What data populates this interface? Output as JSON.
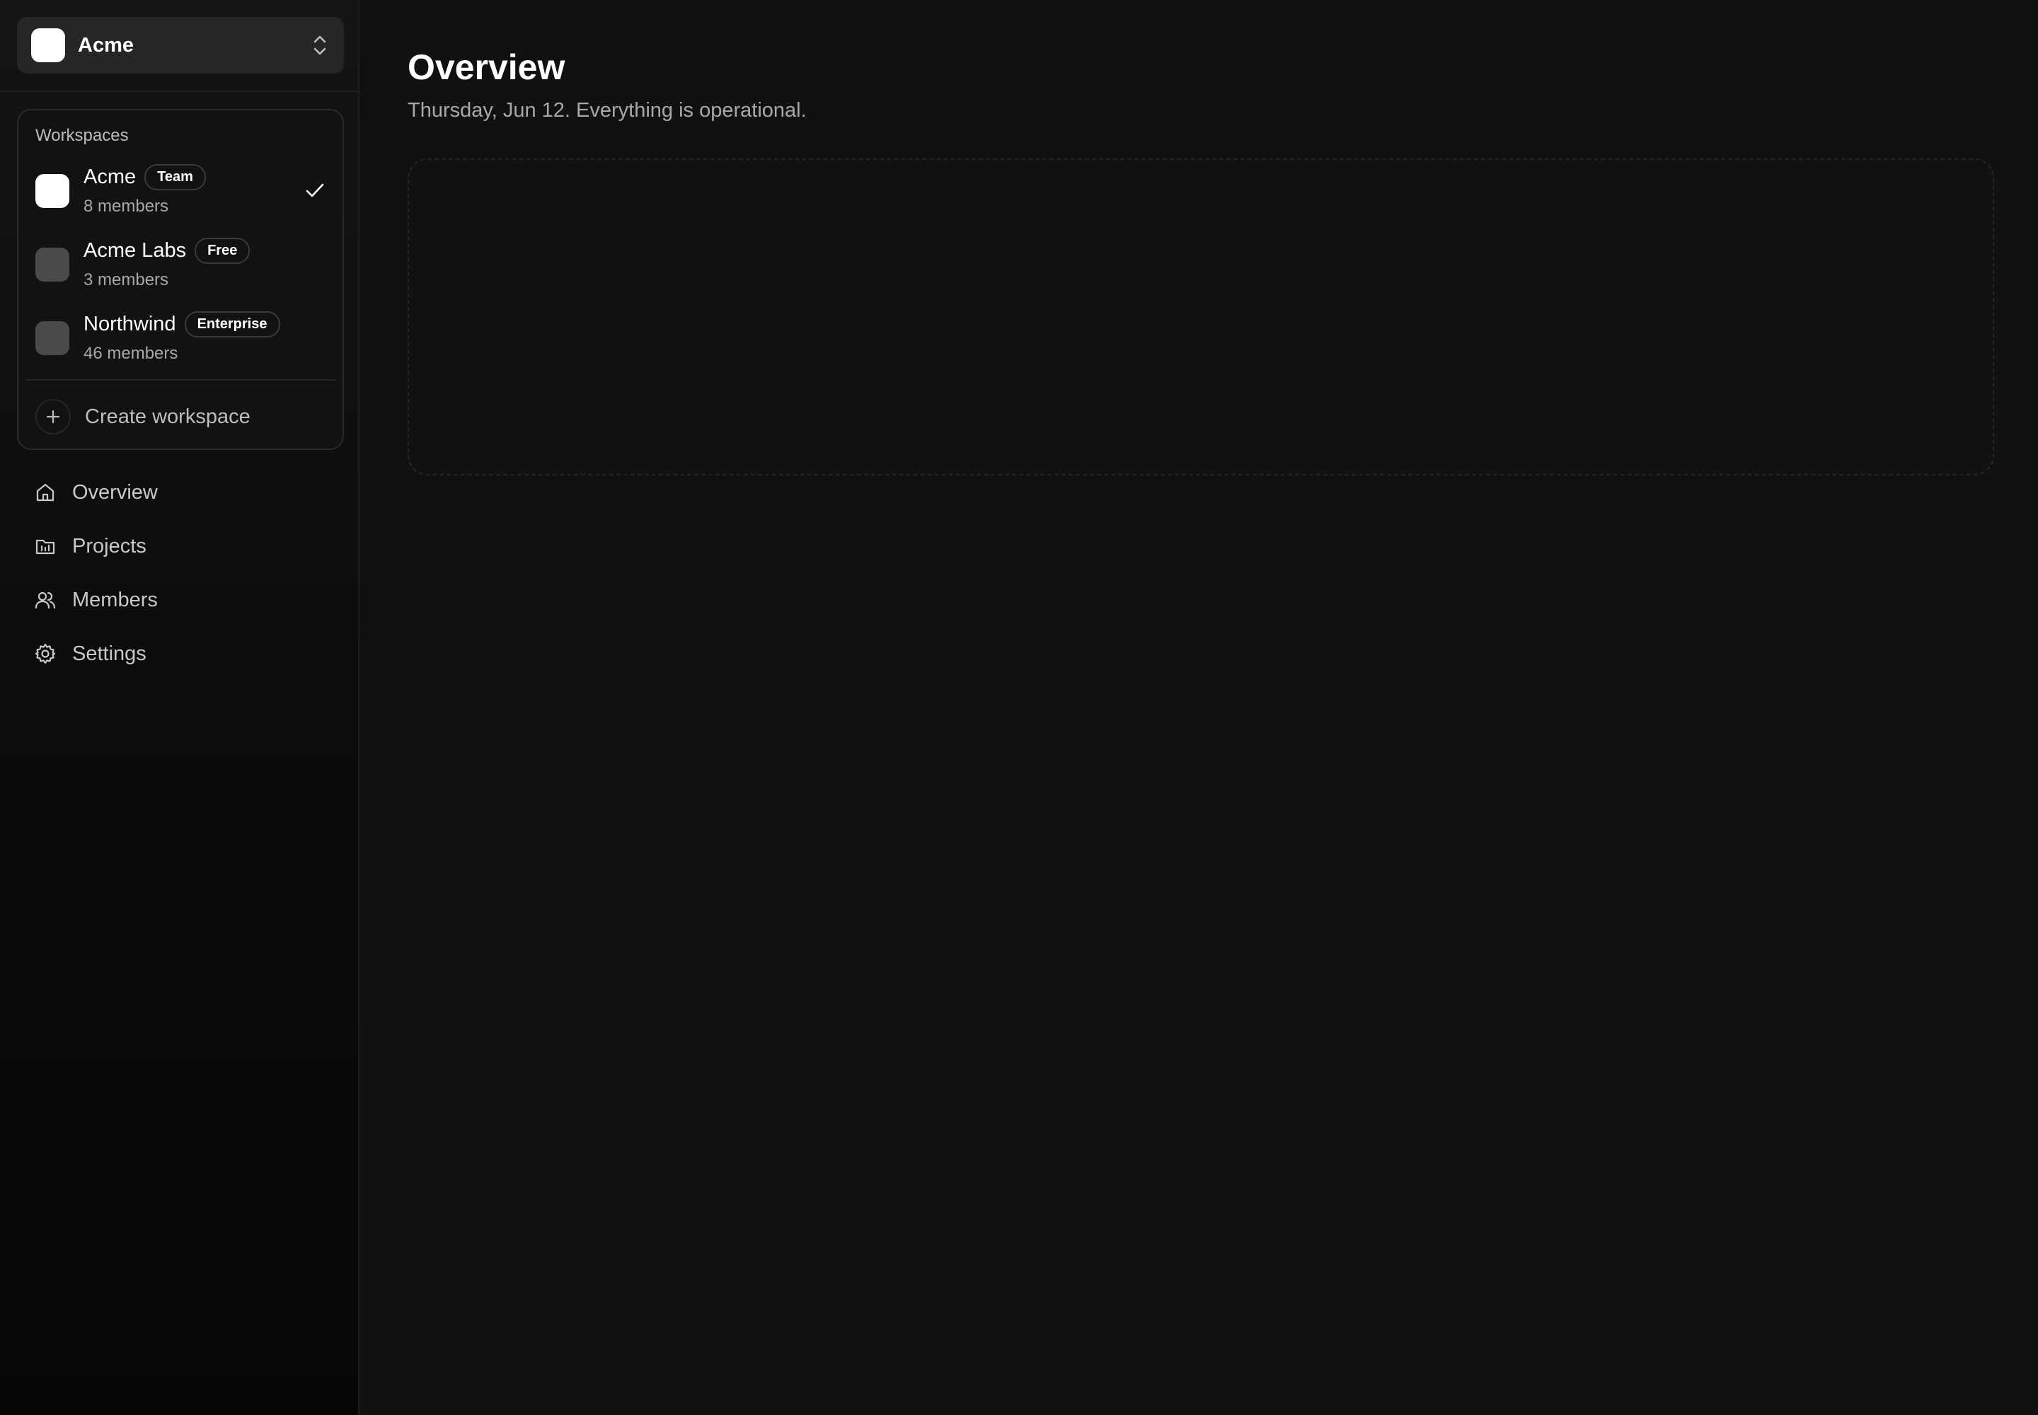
{
  "switcher": {
    "name": "Acme",
    "logo_color": "#ffffff"
  },
  "dropdown": {
    "heading": "Workspaces",
    "items": [
      {
        "name": "Acme",
        "badge": "Team",
        "members": "8 members",
        "selected": true,
        "logo_color": "#ffffff"
      },
      {
        "name": "Acme Labs",
        "badge": "Free",
        "members": "3 members",
        "selected": false,
        "logo_color": "#4a4a4a"
      },
      {
        "name": "Northwind",
        "badge": "Enterprise",
        "members": "46 members",
        "selected": false,
        "logo_color": "#4a4a4a"
      }
    ],
    "create_label": "Create workspace"
  },
  "nav": {
    "items": [
      {
        "label": "Overview",
        "icon": "home-icon"
      },
      {
        "label": "Projects",
        "icon": "folder-chart-icon"
      },
      {
        "label": "Members",
        "icon": "users-icon"
      },
      {
        "label": "Settings",
        "icon": "gear-icon"
      }
    ]
  },
  "main": {
    "title": "Overview",
    "subtitle": "Thursday, Jun 12. Everything is operational."
  },
  "colors": {
    "background": "#111111",
    "sidebar": "#0b0b0b",
    "switcher": "#262626",
    "text": "#ffffff",
    "muted": "#a8a8a8"
  }
}
